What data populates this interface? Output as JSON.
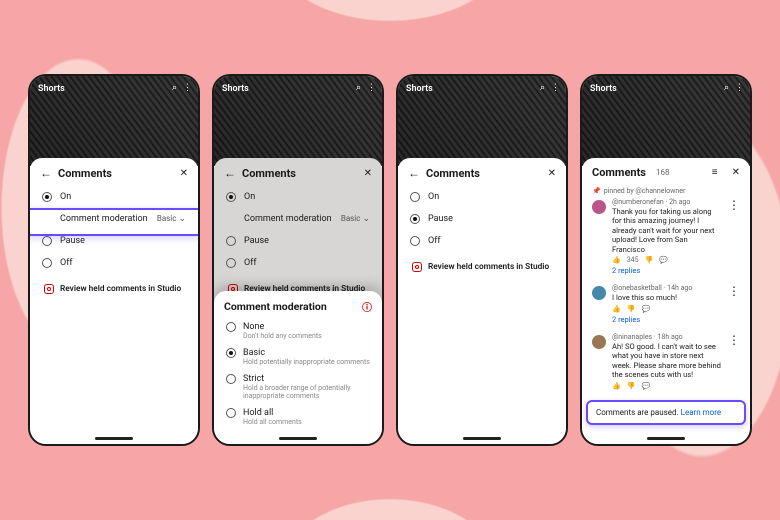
{
  "shorts_label": "Shorts",
  "sheet_title": "Comments",
  "studio_link": "Review held comments in Studio",
  "phone1": {
    "options": [
      "On",
      "Comment moderation",
      "Pause",
      "Off"
    ],
    "selected_index": 0,
    "moderation_value": "Basic"
  },
  "phone2": {
    "options": [
      "On",
      "Comment moderation",
      "Pause",
      "Off"
    ],
    "selected_index": 0,
    "moderation_value": "Basic",
    "modal_title": "Comment moderation",
    "modal_options": [
      {
        "name": "None",
        "desc": "Don't hold any comments"
      },
      {
        "name": "Basic",
        "desc": "Hold potentially inappropriate comments"
      },
      {
        "name": "Strict",
        "desc": "Hold a broader range of potentially inappropriate comments"
      },
      {
        "name": "Hold all",
        "desc": "Hold all comments"
      }
    ],
    "modal_selected_index": 1
  },
  "phone3": {
    "options": [
      "On",
      "Pause",
      "Off"
    ],
    "selected_index": 1
  },
  "phone4": {
    "count": "168",
    "pinned_by": "pinned by @channelowner",
    "comments": [
      {
        "user": "@numberonefan",
        "time": "2h ago",
        "text": "Thank you for taking us along for this amazing journey! I already can't wait for your next upload! Love from San Francisco",
        "likes": "345",
        "replies": "2 replies"
      },
      {
        "user": "@onebasketball",
        "time": "14h ago",
        "text": "I love this so much!",
        "likes": "",
        "replies": "2 replies"
      },
      {
        "user": "@ninanaples",
        "time": "18h ago",
        "text": "Ah! SO good. I can't wait to see what you have in store next week. Please share more behind the scenes cuts with us!",
        "likes": "",
        "replies": ""
      }
    ],
    "paused_text": "Comments are paused.",
    "learn_more": "Learn more"
  }
}
